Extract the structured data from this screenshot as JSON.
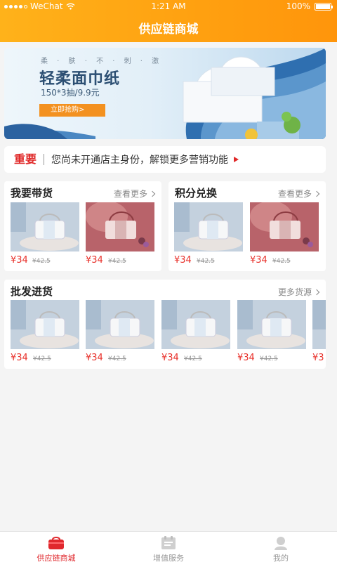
{
  "status_bar": {
    "carrier": "WeChat",
    "time": "1:21 AM",
    "battery": "100%"
  },
  "header": {
    "title": "供应链商城"
  },
  "banner": {
    "tagline": "柔 · 肤 · 不 · 刺 · 激",
    "title": "轻柔面巾纸",
    "subtitle": "150*3抽/9.9元",
    "button": "立即抢购>"
  },
  "notice": {
    "tag": "重要",
    "text": "您尚未开通店主身份，解锁更多营销功能"
  },
  "sections": {
    "sell": {
      "title": "我要带货",
      "more": "查看更多",
      "products": [
        {
          "price": "¥34",
          "old_price": "¥42.5",
          "image": "bag-light-image"
        },
        {
          "price": "¥34",
          "old_price": "¥42.5",
          "image": "bag-pink-image"
        }
      ]
    },
    "points": {
      "title": "积分兑换",
      "more": "查看更多",
      "products": [
        {
          "price": "¥34",
          "old_price": "¥42.5",
          "image": "bag-light-image"
        },
        {
          "price": "¥34",
          "old_price": "¥42.5",
          "image": "bag-pink-image"
        }
      ]
    },
    "wholesale": {
      "title": "批发进货",
      "more": "更多货源",
      "products": [
        {
          "price": "¥34",
          "old_price": "¥42.5"
        },
        {
          "price": "¥34",
          "old_price": "¥42.5"
        },
        {
          "price": "¥34",
          "old_price": "¥42.5"
        },
        {
          "price": "¥34",
          "old_price": "¥42.5"
        },
        {
          "price": "¥3"
        }
      ]
    }
  },
  "tabbar": {
    "items": [
      {
        "label": "供应链商城",
        "icon": "shop-bag-icon",
        "active": true
      },
      {
        "label": "增值服务",
        "icon": "service-list-icon",
        "active": false
      },
      {
        "label": "我的",
        "icon": "user-icon",
        "active": false
      }
    ]
  },
  "colors": {
    "brand": "#ffa010",
    "price": "#e8302a",
    "active_tab": "#e0282d"
  }
}
